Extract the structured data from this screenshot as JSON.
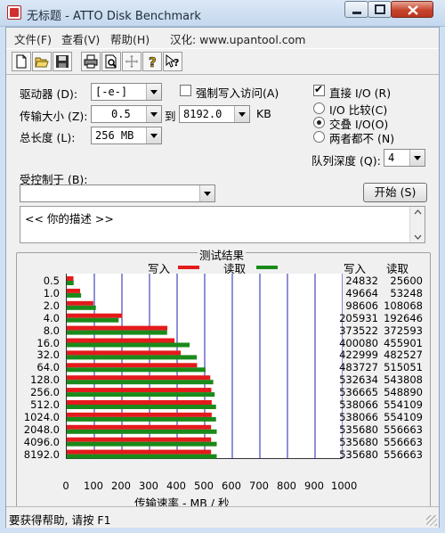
{
  "window": {
    "title": "无标题 - ATTO Disk Benchmark"
  },
  "menu": {
    "items": [
      "文件(F)",
      "查看(V)",
      "帮助(H)",
      "汉化: www.upantool.com"
    ]
  },
  "toolbar": {
    "buttons": [
      "new-file-icon",
      "open-folder-icon",
      "save-disk-icon",
      "print-icon",
      "print-preview-icon",
      "move-cross-icon",
      "help-icon",
      "context-help-icon"
    ]
  },
  "settings": {
    "drive_label": "驱动器 (D):",
    "drive_value": "[-e-]",
    "force_write_label": "强制写入访问(A)",
    "transfer_size_label": "传输大小 (Z):",
    "transfer_from": "0.5",
    "to_label": "到",
    "transfer_to": "8192.0",
    "unit": "KB",
    "total_length_label": "总长度 (L):",
    "total_length_value": "256 MB",
    "direct_io_label": "直接 I/O (R)",
    "compare_io_label": "I/O 比较(C)",
    "overlapped_io_label": "交叠 I/O(O)",
    "neither_label": "两者都不 (N)",
    "queue_depth_label": "队列深度 (Q):",
    "queue_depth_value": "4",
    "controlled_by_label": "受控制于 (B):",
    "controlled_by_value": "",
    "start_button": "开始 (S)",
    "description_text": "<<  你的描述  >>"
  },
  "results": {
    "group_title": "测试结果",
    "legend_write": "写入",
    "legend_read": "读取",
    "col_write": "写入",
    "col_read": "读取",
    "x_axis_label": "传输速率 - MB / 秒",
    "colors": {
      "write": "#e41a1c",
      "read": "#1a8a1a",
      "gridline": "#2020b0"
    }
  },
  "chart_data": {
    "type": "bar",
    "orientation": "horizontal",
    "title": "测试结果",
    "xlabel": "传输速率 - MB / 秒",
    "ylabel": "",
    "xlim": [
      0,
      1000
    ],
    "x_ticks": [
      "0",
      "100",
      "200",
      "300",
      "400",
      "500",
      "600",
      "700",
      "800",
      "900",
      "1000"
    ],
    "categories": [
      "0.5",
      "1.0",
      "2.0",
      "4.0",
      "8.0",
      "16.0",
      "32.0",
      "64.0",
      "128.0",
      "256.0",
      "512.0",
      "1024.0",
      "2048.0",
      "4096.0",
      "8192.0"
    ],
    "series": [
      {
        "name": "写入",
        "values_kbps": [
          24832,
          49664,
          98606,
          205931,
          373522,
          400080,
          422999,
          483727,
          532634,
          536665,
          538066,
          538066,
          535680,
          535680,
          535680
        ]
      },
      {
        "name": "读取",
        "values_kbps": [
          25600,
          53248,
          108068,
          192646,
          372593,
          455901,
          482527,
          515051,
          543808,
          548890,
          554109,
          554109,
          556663,
          556663,
          556663
        ]
      }
    ]
  },
  "status_bar": {
    "text": "要获得帮助, 请按 F1"
  }
}
